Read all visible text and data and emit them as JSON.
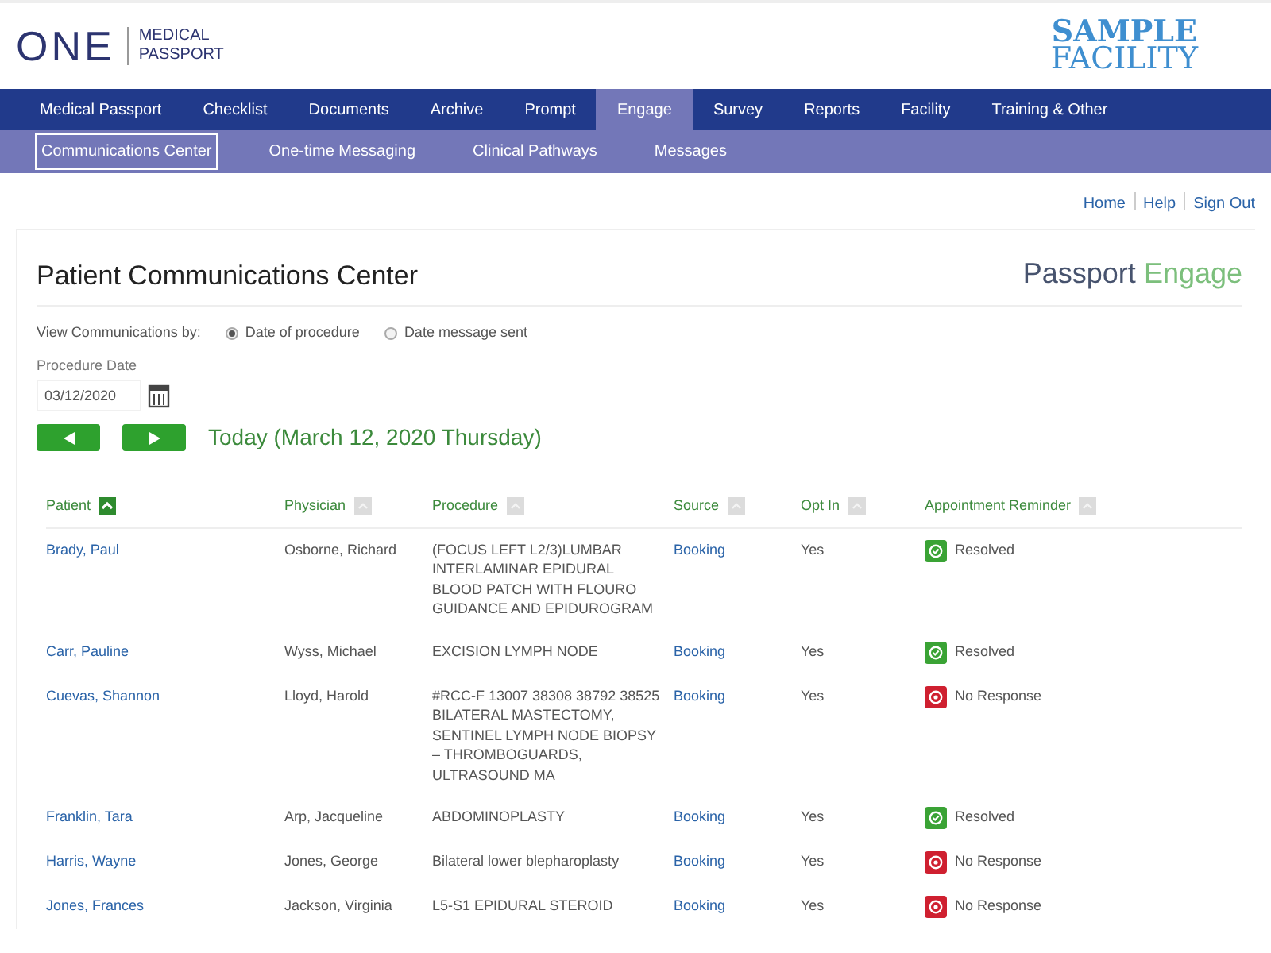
{
  "header": {
    "logo_word": "ONE",
    "logo_sub": [
      "MEDICAL",
      "PASSPORT"
    ],
    "facility": [
      "SAMPLE",
      "FACILITY"
    ]
  },
  "nav": [
    {
      "label": "Medical Passport",
      "selected": false
    },
    {
      "label": "Checklist",
      "selected": false
    },
    {
      "label": "Documents",
      "selected": false
    },
    {
      "label": "Archive",
      "selected": false
    },
    {
      "label": "Prompt",
      "selected": false
    },
    {
      "label": "Engage",
      "selected": true
    },
    {
      "label": "Survey",
      "selected": false
    },
    {
      "label": "Reports",
      "selected": false
    },
    {
      "label": "Facility",
      "selected": false
    },
    {
      "label": "Training & Other",
      "selected": false
    }
  ],
  "subnav": [
    {
      "label": "Communications Center",
      "selected": true
    },
    {
      "label": "One-time Messaging",
      "selected": false
    },
    {
      "label": "Clinical Pathways",
      "selected": false
    },
    {
      "label": "Messages",
      "selected": false
    }
  ],
  "top_links": [
    "Home",
    "Help",
    "Sign Out"
  ],
  "page": {
    "title": "Patient Communications Center",
    "brand": [
      "Passport",
      "Engage"
    ],
    "view_by": {
      "label": "View Communications by:",
      "options": [
        {
          "label": "Date of procedure",
          "selected": true
        },
        {
          "label": "Date message sent",
          "selected": false
        }
      ]
    },
    "date_label": "Procedure Date",
    "date_value": "03/12/2020",
    "today": "Today (March 12, 2020 Thursday)"
  },
  "table": {
    "columns": [
      {
        "label": "Patient",
        "sorted": true
      },
      {
        "label": "Physician",
        "sorted": false
      },
      {
        "label": "Procedure",
        "sorted": false
      },
      {
        "label": "Source",
        "sorted": false
      },
      {
        "label": "Opt In",
        "sorted": false
      },
      {
        "label": "Appointment Reminder",
        "sorted": false
      }
    ],
    "rows": [
      {
        "patient": "Brady, Paul",
        "physician": "Osborne, Richard",
        "procedure": "(FOCUS LEFT L2/3)LUMBAR INTERLAMINAR EPIDURAL BLOOD PATCH WITH FLOURO GUIDANCE AND EPIDUROGRAM",
        "source": "Booking",
        "opt_in": "Yes",
        "reminder": {
          "kind": "resolved",
          "label": "Resolved"
        }
      },
      {
        "patient": "Carr, Pauline",
        "physician": "Wyss, Michael",
        "procedure": "EXCISION LYMPH NODE",
        "source": "Booking",
        "opt_in": "Yes",
        "reminder": {
          "kind": "resolved",
          "label": "Resolved"
        }
      },
      {
        "patient": "Cuevas, Shannon",
        "physician": "Lloyd, Harold",
        "procedure": "#RCC-F 13007 38308 38792 38525 BILATERAL MASTECTOMY, SENTINEL LYMPH NODE BIOPSY – THROMBOGUARDS, ULTRASOUND MA",
        "source": "Booking",
        "opt_in": "Yes",
        "reminder": {
          "kind": "no_response",
          "label": "No Response"
        }
      },
      {
        "patient": "Franklin, Tara",
        "physician": "Arp, Jacqueline",
        "procedure": "ABDOMINOPLASTY",
        "source": "Booking",
        "opt_in": "Yes",
        "reminder": {
          "kind": "resolved",
          "label": "Resolved"
        }
      },
      {
        "patient": "Harris, Wayne",
        "physician": "Jones, George",
        "procedure": "Bilateral lower blepharoplasty",
        "source": "Booking",
        "opt_in": "Yes",
        "reminder": {
          "kind": "no_response",
          "label": "No Response"
        }
      },
      {
        "patient": "Jones, Frances",
        "physician": "Jackson, Virginia",
        "procedure": "L5-S1 EPIDURAL STEROID",
        "source": "Booking",
        "opt_in": "Yes",
        "reminder": {
          "kind": "no_response",
          "label": "No Response"
        }
      }
    ]
  }
}
